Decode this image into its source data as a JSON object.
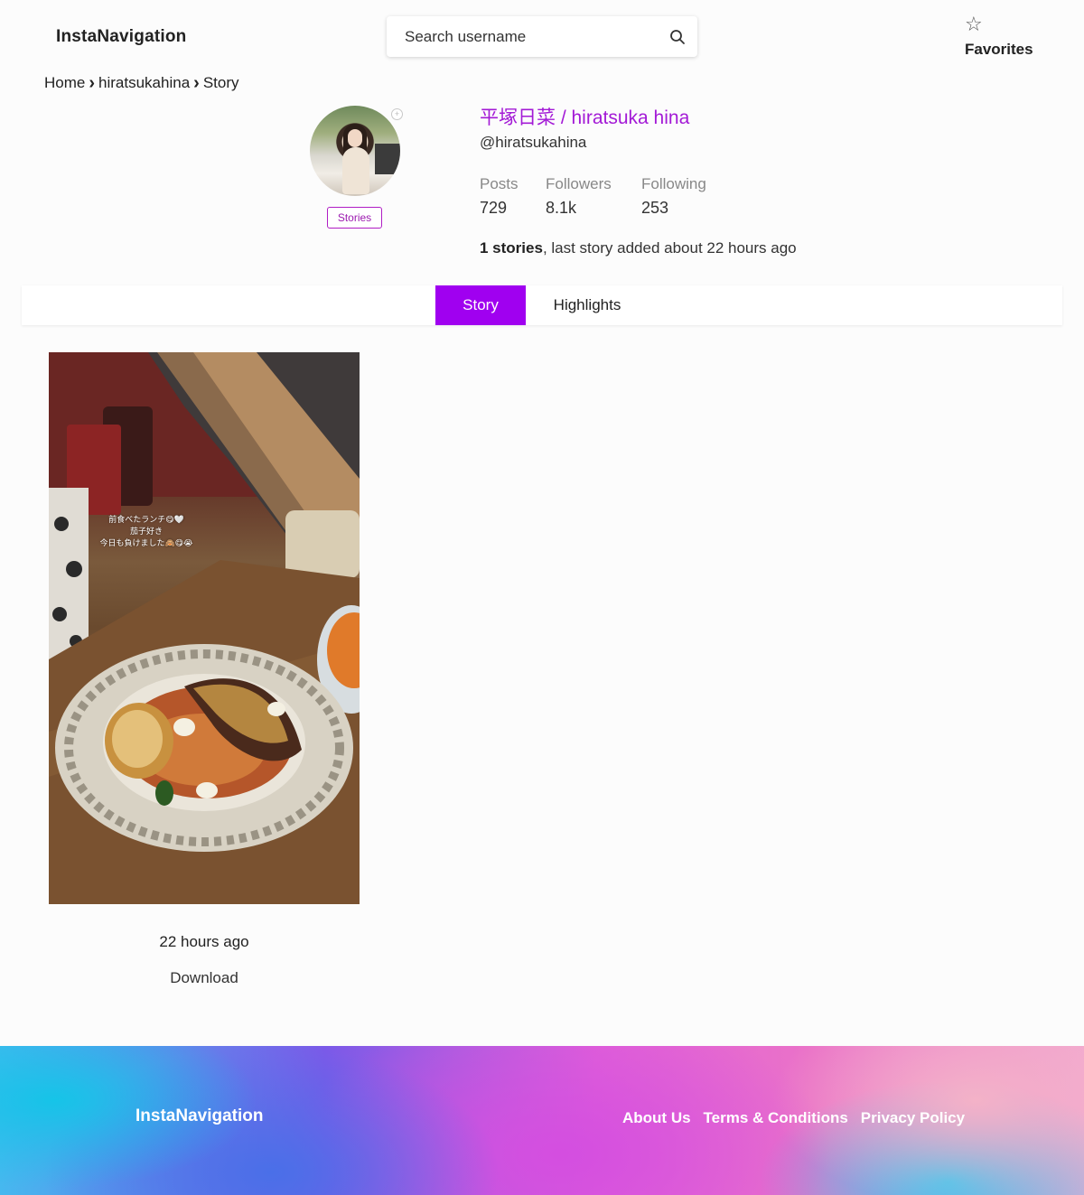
{
  "header": {
    "logo": "InstaNavigation",
    "search_placeholder": "Search username",
    "favorites_label": "Favorites"
  },
  "breadcrumb": {
    "items": [
      "Home",
      "hiratsukahina",
      "Story"
    ]
  },
  "profile": {
    "full_name": "平塚日菜 / hiratsuka hina",
    "handle": "@hiratsukahina",
    "stories_button": "Stories",
    "stats": [
      {
        "label": "Posts",
        "value": "729"
      },
      {
        "label": "Followers",
        "value": "8.1k"
      },
      {
        "label": "Following",
        "value": "253"
      }
    ],
    "summary_bold": "1 stories",
    "summary_rest": ", last story added about 22 hours ago"
  },
  "tabs": [
    {
      "label": "Story",
      "active": true
    },
    {
      "label": "Highlights",
      "active": false
    }
  ],
  "stories": [
    {
      "caption_lines": [
        "前食べたランチ😋🤍",
        "茄子好き",
        "今日も負けました🙈😋😭"
      ],
      "time": "22 hours ago",
      "download_label": "Download"
    }
  ],
  "footer": {
    "logo": "InstaNavigation",
    "links": [
      "About Us",
      "Terms & Conditions",
      "Privacy Policy"
    ]
  },
  "colors": {
    "accent": "#a000f0",
    "name": "#a31ad6"
  }
}
